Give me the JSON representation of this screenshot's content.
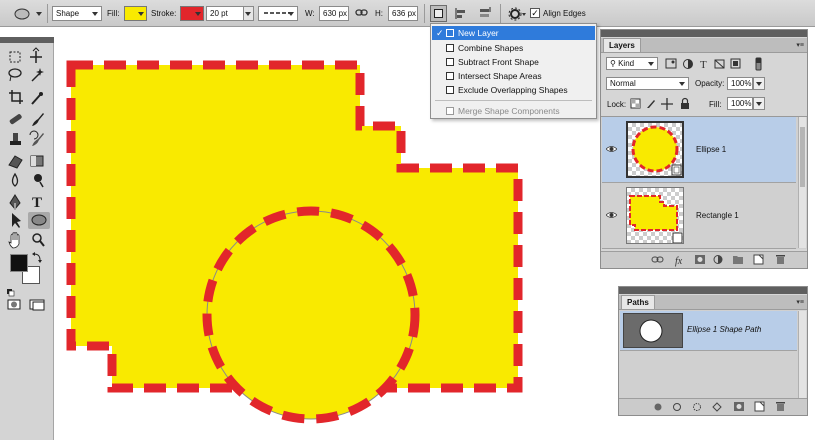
{
  "options_bar": {
    "mode": "Shape",
    "fill_label": "Fill:",
    "stroke_label": "Stroke:",
    "stroke_width": "20 pt",
    "width_label": "W:",
    "width_value": "630 px",
    "height_label": "H:",
    "height_value": "636 px",
    "align_edges_label": "Align Edges",
    "align_edges_checked": true,
    "colors": {
      "fill": "#f9ea00",
      "stroke": "#e2262b"
    }
  },
  "dropdown": {
    "items": [
      {
        "label": "New Layer",
        "selected": true
      },
      {
        "label": "Combine Shapes"
      },
      {
        "label": "Subtract Front Shape"
      },
      {
        "label": "Intersect Shape Areas"
      },
      {
        "label": "Exclude Overlapping Shapes"
      },
      {
        "label": "Merge Shape Components",
        "disabled": true
      }
    ]
  },
  "layers_panel": {
    "tab": "Layers",
    "kind": "Kind",
    "blend_mode": "Normal",
    "opacity_label": "Opacity:",
    "opacity_value": "100%",
    "lock_label": "Lock:",
    "fill_label": "Fill:",
    "fill_value": "100%",
    "layers": [
      {
        "name": "Ellipse 1",
        "selected": true
      },
      {
        "name": "Rectangle 1",
        "selected": false
      }
    ]
  },
  "paths_panel": {
    "tab": "Paths",
    "paths": [
      {
        "name": "Ellipse 1 Shape Path",
        "selected": true
      }
    ]
  },
  "tool_icons": [
    "marquee-icon",
    "move-icon",
    "lasso-icon",
    "magic-wand-icon",
    "crop-icon",
    "eyedropper-icon",
    "healing-icon",
    "brush-icon",
    "stamp-icon",
    "history-brush-icon",
    "eraser-icon",
    "gradient-icon",
    "blur-icon",
    "dodge-icon",
    "pen-icon",
    "type-icon",
    "path-select-icon",
    "ellipse-tool-icon",
    "hand-icon",
    "zoom-icon"
  ]
}
